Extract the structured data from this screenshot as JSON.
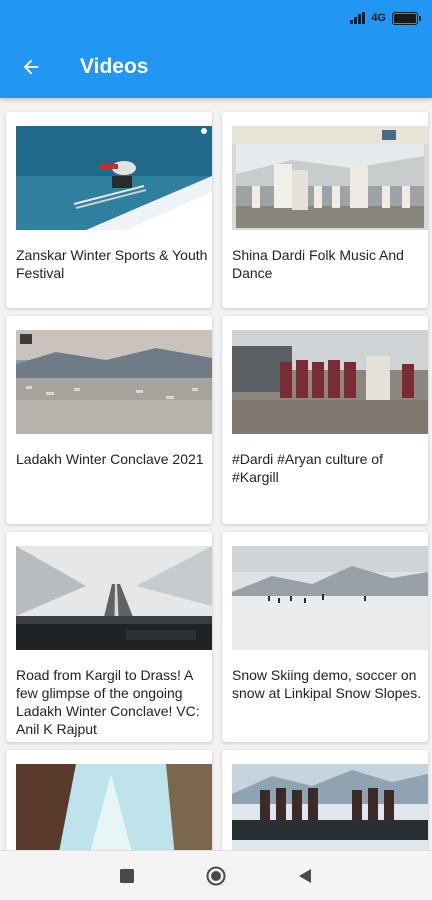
{
  "status_bar": {
    "network": "4G",
    "battery_level": 1.0
  },
  "app_bar": {
    "title": "Videos",
    "back_icon": "arrow-left-icon"
  },
  "videos": [
    {
      "title": "Zanskar Winter Sports & Youth Festival"
    },
    {
      "title": "Shina Dardi Folk Music And Dance"
    },
    {
      "title": "Ladakh Winter Conclave 2021"
    },
    {
      "title": "#Dardi #Aryan culture of #Kargill"
    },
    {
      "title": "Road from Kargil to Drass! A few glimpse of the ongoing Ladakh Winter Conclave! VC: Anil K Rajput"
    },
    {
      "title": "Snow Skiing demo, soccer on snow  at Linkipal Snow Slopes."
    },
    {
      "title": ""
    },
    {
      "title": ""
    }
  ],
  "nav_bar": {
    "recents_icon": "square-icon",
    "home_icon": "circle-icon",
    "back_icon": "triangle-back-icon"
  }
}
